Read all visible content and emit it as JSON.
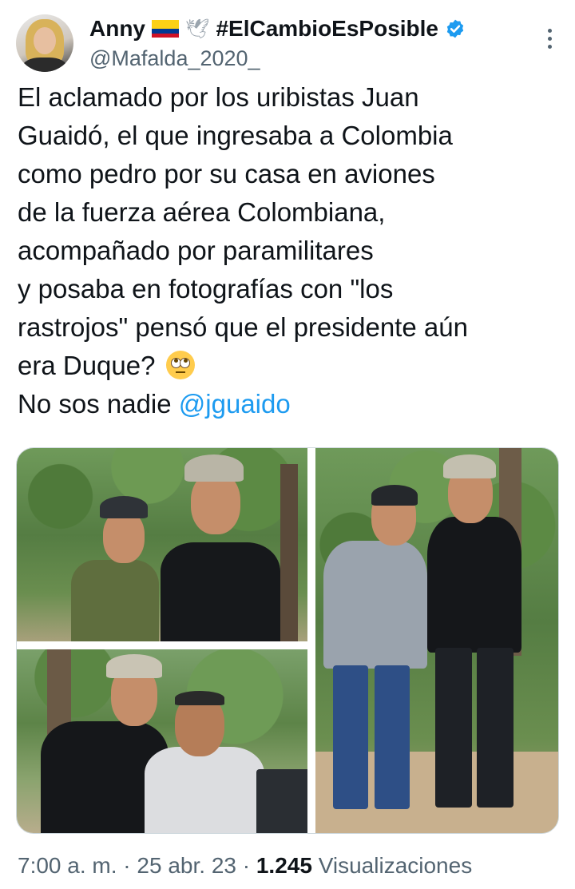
{
  "tweet": {
    "author_name": "Anny",
    "author_hashtag": "#ElCambioEsPosible",
    "author_handle": "@Mafalda_2020_",
    "text_lines": [
      "El aclamado por los uribistas Juan",
      "Guaidó, el que ingresaba a Colombia",
      "como pedro por su casa en aviones",
      "de la fuerza aérea Colombiana,",
      "acompañado por paramilitares",
      "y posaba en fotografías con \"los",
      "rastrojos\" pensó que el presidente aún",
      "era Duque?"
    ],
    "last_line_prefix": "No sos nadie ",
    "mention": "@jguaido",
    "time": "7:00 a. m.",
    "date": "25 abr. 23",
    "view_count": "1.245",
    "views_label": "Visualizaciones",
    "separator": "·"
  },
  "icons": {
    "flag": "colombia-flag-icon",
    "dove": "dove-icon",
    "verified": "verified-badge-icon",
    "more": "more-options-icon",
    "emoji": "face-with-rolling-eyes-emoji"
  },
  "colors": {
    "link": "#1d9bf0",
    "secondary_text": "#536471",
    "primary_text": "#0f1419",
    "verified": "#1d9bf0"
  }
}
